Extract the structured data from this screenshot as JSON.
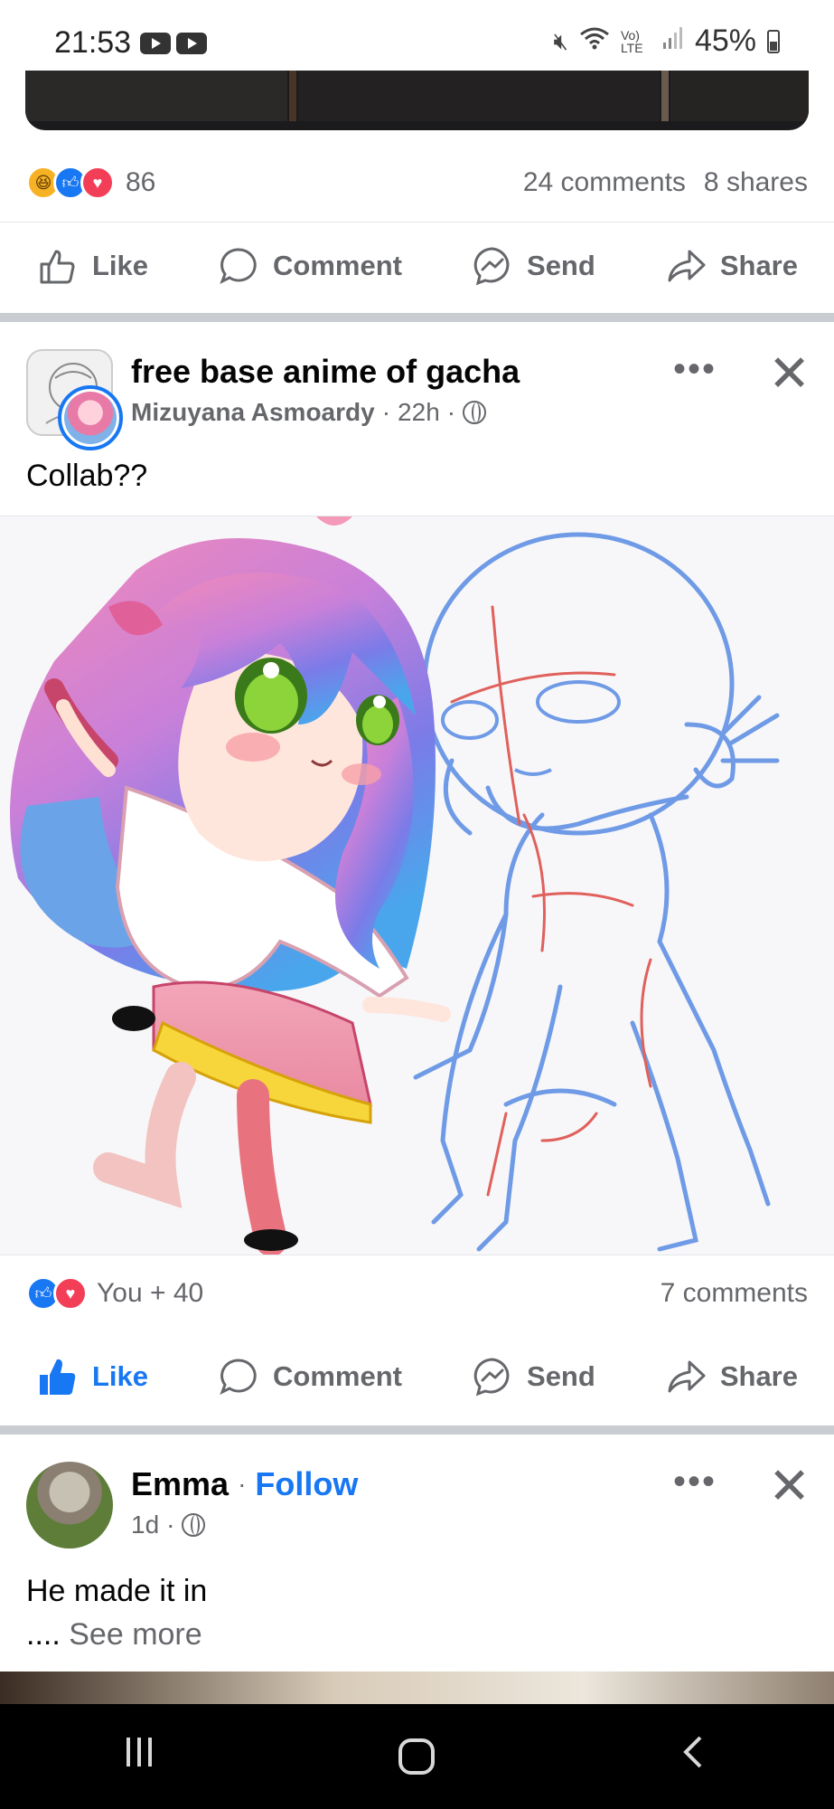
{
  "status_bar": {
    "time": "21:53",
    "battery": "45%",
    "network": "Vo) LTE"
  },
  "prev_post": {
    "reaction_count": "86",
    "comments": "24 comments",
    "shares": "8 shares"
  },
  "actions": {
    "like": "Like",
    "comment": "Comment",
    "send": "Send",
    "share": "Share"
  },
  "post": {
    "group_name": "free base anime of gacha",
    "author": "Mizuyana Asmoardy",
    "time": "22h",
    "separator": "·",
    "text": "Collab??",
    "reaction_summary": "You + 40",
    "comments": "7 comments",
    "liked": true
  },
  "next_post": {
    "author": "Emma",
    "follow_label": "Follow",
    "time": "1d",
    "text_line1": "He made it in",
    "text_line2_prefix": "....",
    "see_more": "See more"
  },
  "colors": {
    "accent": "#1877f2",
    "muted": "#65676b",
    "divider": "#c9ccd1"
  }
}
